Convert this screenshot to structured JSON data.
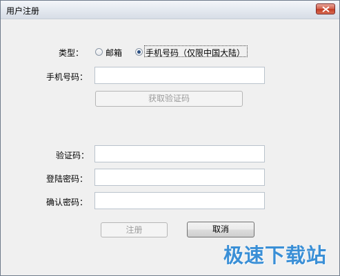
{
  "window": {
    "title": "用户注册",
    "close_icon": "close-icon"
  },
  "form": {
    "type_label": "类型：",
    "type_options": [
      {
        "label": "邮箱",
        "selected": false
      },
      {
        "label": "手机号码（仅限中国大陆）",
        "selected": true
      }
    ],
    "phone_label": "手机号码：",
    "phone_value": "",
    "get_code_button": "获取验证码",
    "code_label": "验证码：",
    "code_value": "",
    "password_label": "登陆密码：",
    "password_value": "",
    "confirm_label": "确认密码：",
    "confirm_value": ""
  },
  "buttons": {
    "register": "注册",
    "cancel": "取消"
  },
  "watermark": "极速下载站",
  "colors": {
    "watermark": "#3a8fd6",
    "close_button": "#c94a33",
    "radio_dot": "#2b4f83"
  }
}
